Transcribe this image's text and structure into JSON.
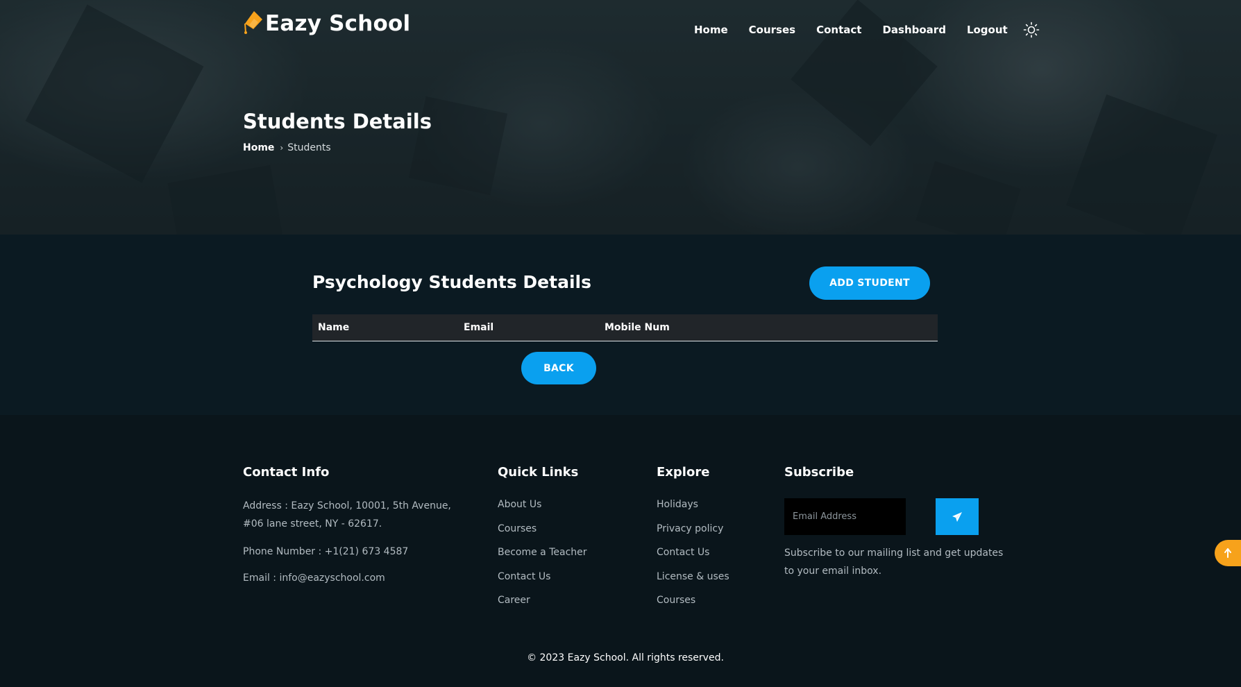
{
  "brand": {
    "name": "Eazy School",
    "accent": "#f7a21b"
  },
  "nav": {
    "items": [
      "Home",
      "Courses",
      "Contact",
      "Dashboard",
      "Logout"
    ],
    "theme_toggle_icon": "sun-icon"
  },
  "hero": {
    "title": "Students Details",
    "breadcrumb": {
      "home": "Home",
      "separator": "›",
      "current": "Students"
    }
  },
  "main": {
    "title": "Psychology Students Details",
    "add_button": "ADD STUDENT",
    "back_button": "BACK",
    "table": {
      "headers": [
        "Name",
        "Email",
        "Mobile Num"
      ],
      "rows": []
    }
  },
  "footer": {
    "contact": {
      "heading": "Contact Info",
      "address": "Address : Eazy School, 10001, 5th Avenue, #06 lane street, NY - 62617.",
      "phone": "Phone Number : +1(21) 673 4587",
      "email": "Email : info@eazyschool.com"
    },
    "quick_links": {
      "heading": "Quick Links",
      "items": [
        "About Us",
        "Courses",
        "Become a Teacher",
        "Contact Us",
        "Career"
      ]
    },
    "explore": {
      "heading": "Explore",
      "items": [
        "Holidays",
        "Privacy policy",
        "Contact Us",
        "License & uses",
        "Courses"
      ]
    },
    "subscribe": {
      "heading": "Subscribe",
      "placeholder": "Email Address",
      "button_icon": "paper-plane-icon",
      "text": "Subscribe to our mailing list and get updates to your email inbox."
    },
    "copyright": "© 2023 Eazy School. All rights reserved."
  },
  "colors": {
    "primary": "#0aa0ef",
    "background": "#0b1a22",
    "footer": "#0a151b",
    "table_head": "#212529"
  }
}
